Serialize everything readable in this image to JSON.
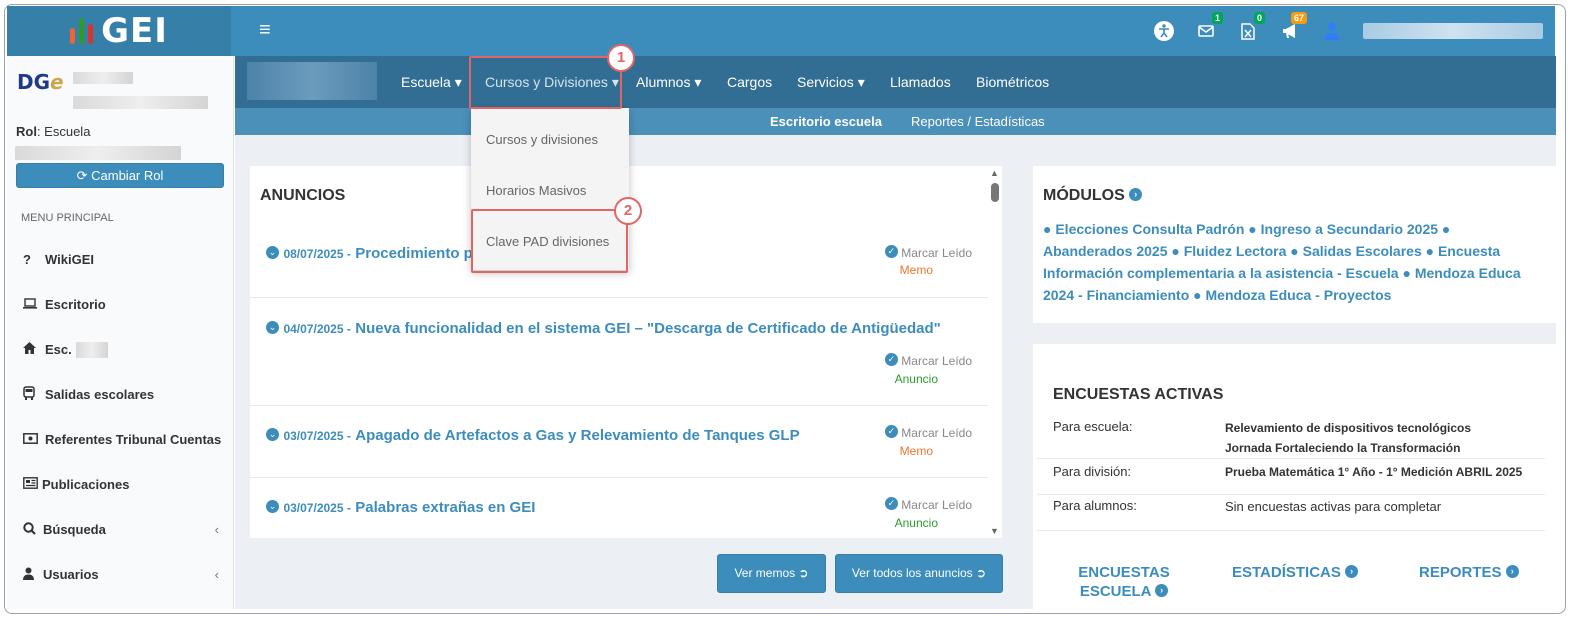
{
  "topbar": {
    "logo_text": "GEI",
    "menu_glyph": "≡",
    "badges": {
      "mail": "1",
      "calc": "0",
      "notify": "67"
    }
  },
  "sidebar": {
    "rol_label": "Rol",
    "rol_value": ": Escuela",
    "cambiar_rol": "Cambiar Rol",
    "menu_header": "MENU PRINCIPAL",
    "items": [
      {
        "label": "WikiGEI",
        "icon": "question-icon"
      },
      {
        "label": "Escritorio",
        "icon": "laptop-icon"
      },
      {
        "label": "Esc.",
        "icon": "home-icon"
      },
      {
        "label": "Salidas escolares",
        "icon": "bus-icon"
      },
      {
        "label": "Referentes Tribunal Cuentas",
        "icon": "money-icon"
      },
      {
        "label": "Publicaciones",
        "icon": "newspaper-icon"
      },
      {
        "label": "Búsqueda",
        "icon": "search-icon"
      },
      {
        "label": "Usuarios",
        "icon": "user-icon"
      }
    ]
  },
  "nav": {
    "items": [
      "Escuela",
      "Cursos y Divisiones",
      "Alumnos",
      "Cargos",
      "Servicios",
      "Llamados",
      "Biométricos"
    ],
    "sub_items": [
      "Escritorio escuela",
      "Reportes / Estadísticas"
    ]
  },
  "dropdown": {
    "items": [
      "Cursos y divisiones",
      "Horarios Masivos",
      "Clave PAD divisiones"
    ]
  },
  "callouts": [
    "1",
    "2"
  ],
  "anuncios": {
    "title": "ANUNCIOS",
    "mark_read": "Marcar Leído",
    "items": [
      {
        "date": "08/07/2025 -",
        "title": "Procedimiento para ... novedades",
        "tag": "Memo"
      },
      {
        "date": "04/07/2025 -",
        "title": "Nueva funcionalidad en el sistema GEI – \"Descarga de Certificado de Antigüedad\"",
        "tag": "Anuncio"
      },
      {
        "date": "03/07/2025 -",
        "title": "Apagado de Artefactos a Gas y Relevamiento de Tanques GLP",
        "tag": "Memo"
      },
      {
        "date": "03/07/2025 -",
        "title": "Palabras extrañas en GEI",
        "tag": "Anuncio"
      }
    ],
    "btn_memos": "Ver memos",
    "btn_todos": "Ver todos los anuncios"
  },
  "modulos": {
    "title": "MÓDULOS",
    "text": "● Elecciones Consulta Padrón ● Ingreso a Secundario 2025 ● Abanderados 2025 ● Fluidez Lectora ● Salidas Escolares ● Encuesta Información complementaria a la asistencia - Escuela ● Mendoza Educa 2024 - Financiamiento ● Mendoza Educa - Proyectos"
  },
  "encuestas": {
    "title": "ENCUESTAS ACTIVAS",
    "rows": [
      {
        "label": "Para escuela:",
        "value1": "Relevamiento de dispositivos tecnológicos",
        "value2": "Jornada Fortaleciendo la Transformación"
      },
      {
        "label": "Para división:",
        "value1": "Prueba Matemática 1° Año - 1° Medición ABRIL 2025"
      },
      {
        "label": "Para alumnos:",
        "value1": "Sin encuestas activas para completar"
      }
    ],
    "link1_line1": "ENCUESTAS",
    "link1_line2": "ESCUELA",
    "link2": "ESTADÍSTICAS",
    "link3": "REPORTES"
  },
  "colors": {
    "primary": "#3c8dbc",
    "nav": "#326e93",
    "memo": "#f0752f",
    "anuncio": "#2e9a2e",
    "highlight": "#e06666"
  }
}
